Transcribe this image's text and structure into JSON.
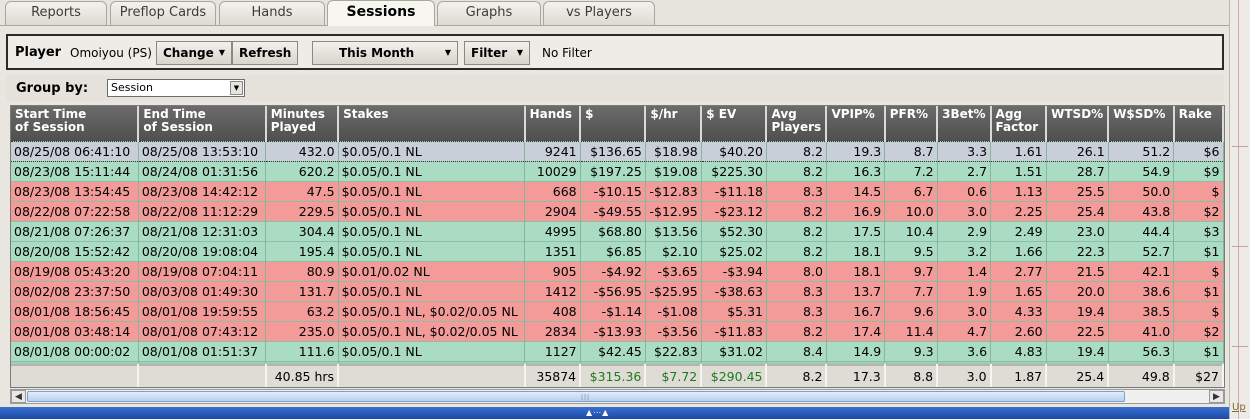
{
  "tabs": [
    {
      "label": "Reports",
      "active": false
    },
    {
      "label": "Preflop Cards",
      "active": false
    },
    {
      "label": "Hands",
      "active": false
    },
    {
      "label": "Sessions",
      "active": true
    },
    {
      "label": "Graphs",
      "active": false
    },
    {
      "label": "vs Players",
      "active": false
    }
  ],
  "player_bar": {
    "label": "Player",
    "player": "Omoiyou (PS)",
    "change": "Change",
    "refresh": "Refresh",
    "period": "This Month",
    "filter": "Filter",
    "filter_status": "No Filter"
  },
  "group_by": {
    "label": "Group by:",
    "value": "Session"
  },
  "columns": [
    "Start Time\nof Session",
    "End Time\nof Session",
    "Minutes\nPlayed",
    "Stakes",
    "Hands",
    "$",
    "$/hr",
    "$ EV",
    "Avg\nPlayers",
    "VPIP%",
    "PFR%",
    "3Bet%",
    "Agg\nFactor",
    "WTSD%",
    "W$SD%",
    "Rake"
  ],
  "rows": [
    {
      "status": "selected",
      "cells": [
        "08/25/08 06:41:10",
        "08/25/08 13:53:10",
        "432.0",
        "$0.05/0.1 NL",
        "9241",
        "$136.65",
        "$18.98",
        "$40.20",
        "8.2",
        "19.3",
        "8.7",
        "3.3",
        "1.61",
        "26.1",
        "51.2",
        "$6"
      ]
    },
    {
      "status": "win",
      "cells": [
        "08/23/08 15:11:44",
        "08/24/08 01:31:56",
        "620.2",
        "$0.05/0.1 NL",
        "10029",
        "$197.25",
        "$19.08",
        "$225.30",
        "8.2",
        "16.3",
        "7.2",
        "2.7",
        "1.51",
        "28.7",
        "54.9",
        "$9"
      ]
    },
    {
      "status": "loss",
      "cells": [
        "08/23/08 13:54:45",
        "08/23/08 14:42:12",
        "47.5",
        "$0.05/0.1 NL",
        "668",
        "-$10.15",
        "-$12.83",
        "-$11.18",
        "8.3",
        "14.5",
        "6.7",
        "0.6",
        "1.13",
        "25.5",
        "50.0",
        "$"
      ]
    },
    {
      "status": "loss",
      "cells": [
        "08/22/08 07:22:58",
        "08/22/08 11:12:29",
        "229.5",
        "$0.05/0.1 NL",
        "2904",
        "-$49.55",
        "-$12.95",
        "-$23.12",
        "8.2",
        "16.9",
        "10.0",
        "3.0",
        "2.25",
        "25.4",
        "43.8",
        "$2"
      ]
    },
    {
      "status": "win",
      "cells": [
        "08/21/08 07:26:37",
        "08/21/08 12:31:03",
        "304.4",
        "$0.05/0.1 NL",
        "4995",
        "$68.80",
        "$13.56",
        "$52.30",
        "8.2",
        "17.5",
        "10.4",
        "2.9",
        "2.49",
        "23.0",
        "44.4",
        "$3"
      ]
    },
    {
      "status": "win",
      "cells": [
        "08/20/08 15:52:42",
        "08/20/08 19:08:04",
        "195.4",
        "$0.05/0.1 NL",
        "1351",
        "$6.85",
        "$2.10",
        "$25.02",
        "8.2",
        "18.1",
        "9.5",
        "3.2",
        "1.66",
        "22.3",
        "52.7",
        "$1"
      ]
    },
    {
      "status": "loss",
      "cells": [
        "08/19/08 05:43:20",
        "08/19/08 07:04:11",
        "80.9",
        "$0.01/0.02 NL",
        "905",
        "-$4.92",
        "-$3.65",
        "-$3.94",
        "8.0",
        "18.1",
        "9.7",
        "1.4",
        "2.77",
        "21.5",
        "42.1",
        "$"
      ]
    },
    {
      "status": "loss",
      "cells": [
        "08/02/08 23:37:50",
        "08/03/08 01:49:30",
        "131.7",
        "$0.05/0.1 NL",
        "1412",
        "-$56.95",
        "-$25.95",
        "-$38.63",
        "8.3",
        "13.7",
        "7.7",
        "1.9",
        "1.65",
        "20.0",
        "38.6",
        "$1"
      ]
    },
    {
      "status": "loss",
      "cells": [
        "08/01/08 18:56:45",
        "08/01/08 19:59:55",
        "63.2",
        "$0.05/0.1 NL, $0.02/0.05 NL",
        "408",
        "-$1.14",
        "-$1.08",
        "$5.31",
        "8.3",
        "16.7",
        "9.6",
        "3.0",
        "4.33",
        "19.4",
        "38.5",
        "$"
      ]
    },
    {
      "status": "loss",
      "cells": [
        "08/01/08 03:48:14",
        "08/01/08 07:43:12",
        "235.0",
        "$0.05/0.1 NL, $0.02/0.05 NL",
        "2834",
        "-$13.93",
        "-$3.56",
        "-$11.83",
        "8.2",
        "17.4",
        "11.4",
        "4.7",
        "2.60",
        "22.5",
        "41.0",
        "$2"
      ]
    },
    {
      "status": "win",
      "cells": [
        "08/01/08 00:00:02",
        "08/01/08 01:51:37",
        "111.6",
        "$0.05/0.1 NL",
        "1127",
        "$42.45",
        "$22.83",
        "$31.02",
        "8.4",
        "14.9",
        "9.3",
        "3.6",
        "4.83",
        "19.4",
        "56.3",
        "$1"
      ]
    }
  ],
  "summary": [
    "",
    "",
    "40.85 hrs",
    "",
    "35874",
    "$315.36",
    "$7.72",
    "$290.45",
    "8.2",
    "17.3",
    "8.8",
    "3.0",
    "1.87",
    "25.4",
    "49.8",
    "$27"
  ],
  "side_link": "Up",
  "colors": {
    "win_row": "#a9dcc3",
    "loss_row": "#f29b98",
    "header": "#5a5a5a",
    "positive_total": "#1f7a1f"
  }
}
